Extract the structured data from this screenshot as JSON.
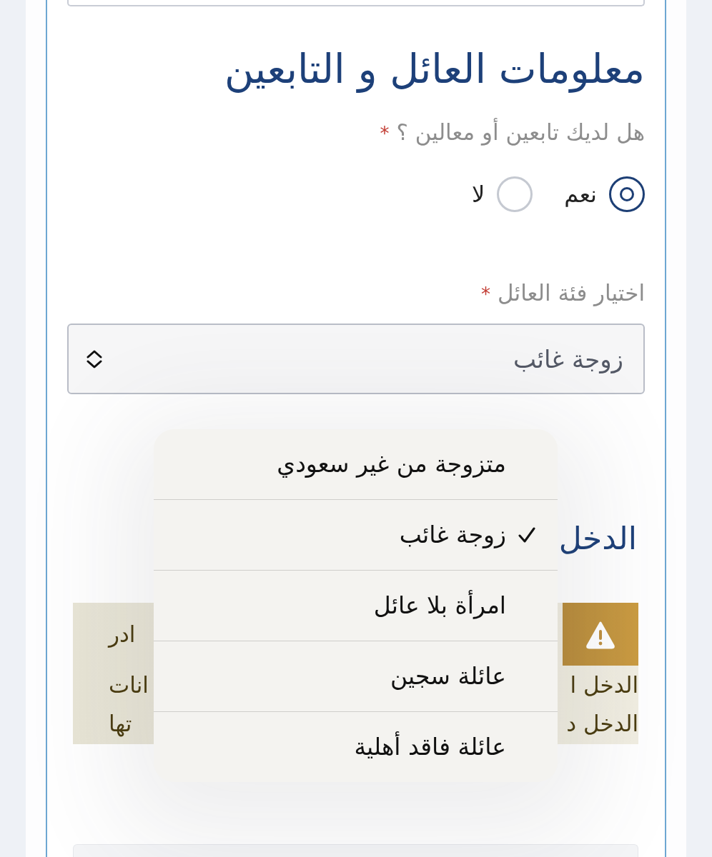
{
  "family_section": {
    "title": "معلومات العائل و التابعين",
    "dependents_question": {
      "label": "هل لديك تابعين أو معالين ؟",
      "required_mark": "*",
      "options": [
        {
          "label": "نعم",
          "selected": true
        },
        {
          "label": "لا",
          "selected": false
        }
      ]
    },
    "provider_category": {
      "label": "اختيار فئة العائل",
      "required_mark": "*",
      "value": "زوجة غائب"
    }
  },
  "income_section": {
    "title": "الدخل",
    "alert": {
      "title_end": "ادر",
      "lines": [
        {
          "start": "الدخل ا",
          "end": "انات"
        },
        {
          "start": "الدخل د",
          "end": "تها"
        }
      ]
    }
  },
  "dropdown_menu": {
    "options": [
      {
        "label": "متزوجة من غير سعودي",
        "selected": false
      },
      {
        "label": "زوجة غائب",
        "selected": true
      },
      {
        "label": "امرأة بلا عائل",
        "selected": false
      },
      {
        "label": "عائلة سجين",
        "selected": false
      },
      {
        "label": "عائلة فاقد أهلية",
        "selected": false
      }
    ]
  }
}
